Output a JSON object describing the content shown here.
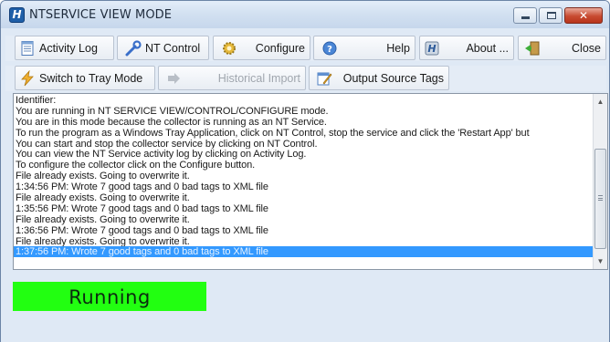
{
  "window": {
    "title": "NTSERVICE VIEW MODE",
    "app_icon_letter": "H",
    "caption_buttons": [
      "minimize",
      "maximize",
      "close"
    ]
  },
  "toolbar1": {
    "activity_log": "Activity Log",
    "nt_control": "NT Control",
    "configure": "Configure",
    "help": "Help",
    "about": "About ...",
    "close": "Close"
  },
  "toolbar2": {
    "switch_tray": "Switch to Tray Mode",
    "historical_import": "Historical Import",
    "output_source_tags": "Output Source Tags"
  },
  "log": {
    "lines": [
      "Identifier:",
      "You are running in NT SERVICE VIEW/CONTROL/CONFIGURE mode.",
      "You are in this mode because the collector is running as an NT Service.",
      "To run the program as a Windows Tray Application, click on NT Control, stop the service and click the 'Restart App' but",
      "You can start and stop the collector service by clicking on NT Control.",
      "You can view the NT Service activity log by clicking on Activity Log.",
      "To configure the collector click on the Configure button.",
      "File already exists. Going to overwrite it.",
      "1:34:56 PM: Wrote 7 good tags and 0 bad tags to XML file",
      "File already exists. Going to overwrite it.",
      "1:35:56 PM: Wrote 7 good tags and 0 bad tags to XML file",
      "File already exists. Going to overwrite it.",
      "1:36:56 PM: Wrote 7 good tags and 0 bad tags to XML file",
      "File already exists. Going to overwrite it.",
      "1:37:56 PM: Wrote 7 good tags and 0 bad tags to XML file"
    ],
    "selected_index": 14
  },
  "status": {
    "text": "Running",
    "color": "#22ff11"
  },
  "colors": {
    "selection": "#3399ff",
    "window_bg": "#dfe9f5"
  }
}
